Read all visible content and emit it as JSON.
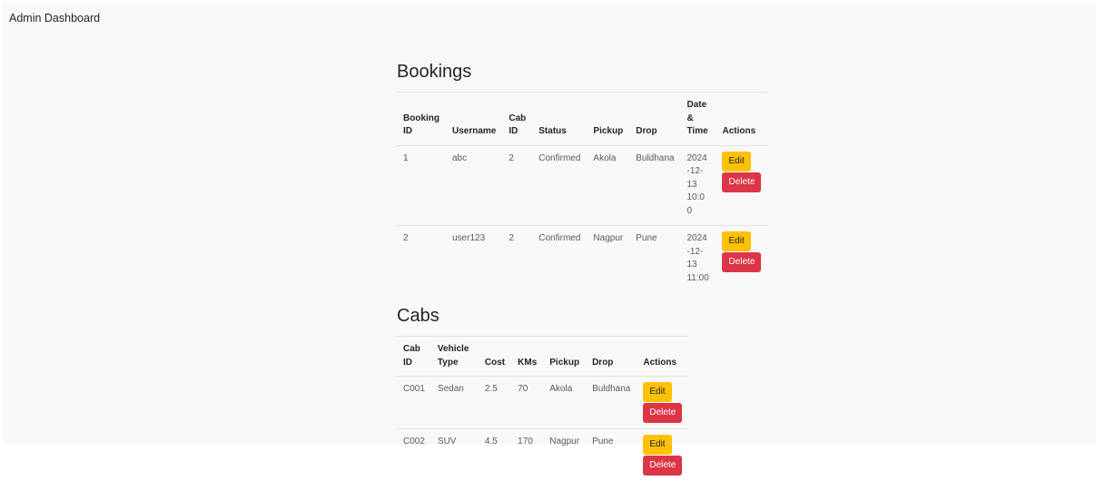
{
  "navbar": {
    "brand": "Admin Dashboard"
  },
  "bookings": {
    "title": "Bookings",
    "headers": [
      "Booking ID",
      "Username",
      "Cab ID",
      "Status",
      "Pickup",
      "Drop",
      "Date & Time",
      "Actions"
    ],
    "rows": [
      {
        "booking_id": "1",
        "username": "abc",
        "cab_id": "2",
        "status": "Confirmed",
        "pickup": "Akola",
        "drop": "Buldhana",
        "datetime": "2024-12-13 10:00"
      },
      {
        "booking_id": "2",
        "username": "user123",
        "cab_id": "2",
        "status": "Confirmed",
        "pickup": "Nagpur",
        "drop": "Pune",
        "datetime": "2024-12-13 11:00"
      }
    ]
  },
  "cabs": {
    "title": "Cabs",
    "headers": [
      "Cab ID",
      "Vehicle Type",
      "Cost",
      "KMs",
      "Pickup",
      "Drop",
      "Actions"
    ],
    "rows": [
      {
        "cab_id": "C001",
        "vehicle_type": "Sedan",
        "cost": "2.5",
        "kms": "70",
        "pickup": "Akola",
        "drop": "Buldhana"
      },
      {
        "cab_id": "C002",
        "vehicle_type": "SUV",
        "cost": "4.5",
        "kms": "170",
        "pickup": "Nagpur",
        "drop": "Pune"
      }
    ]
  },
  "buttons": {
    "edit": "Edit",
    "delete": "Delete"
  },
  "colors": {
    "edit": "#ffc107",
    "delete": "#dc3545",
    "background": "#f8f8f8"
  }
}
